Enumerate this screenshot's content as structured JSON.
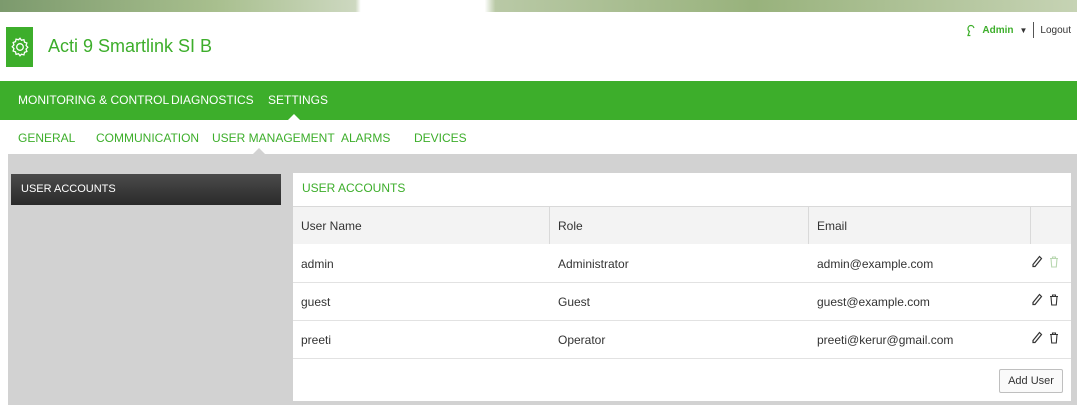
{
  "app": {
    "title": "Acti 9 Smartlink SI B"
  },
  "user": {
    "name": "Admin",
    "logout": "Logout"
  },
  "main_nav": [
    {
      "label": "MONITORING & CONTROL"
    },
    {
      "label": "DIAGNOSTICS"
    },
    {
      "label": "SETTINGS",
      "active": true
    }
  ],
  "sub_nav": [
    {
      "label": "GENERAL"
    },
    {
      "label": "COMMUNICATION"
    },
    {
      "label": "USER MANAGEMENT",
      "active": true
    },
    {
      "label": "ALARMS"
    },
    {
      "label": "DEVICES"
    }
  ],
  "sidebar": {
    "items": [
      {
        "label": "USER ACCOUNTS",
        "active": true
      }
    ]
  },
  "panel": {
    "title": "USER ACCOUNTS",
    "columns": [
      "User Name",
      "Role",
      "Email"
    ],
    "rows": [
      {
        "username": "admin",
        "role": "Administrator",
        "email": "admin@example.com"
      },
      {
        "username": "guest",
        "role": "Guest",
        "email": "guest@example.com"
      },
      {
        "username": "preeti",
        "role": "Operator",
        "email": "preeti@kerur@gmail.com"
      }
    ],
    "add_user_label": "Add User"
  },
  "icons": {
    "logo": "gear-icon",
    "user": "user-icon",
    "edit": "pencil-icon",
    "delete": "trash-icon"
  },
  "colors": {
    "brand": "#3dae2b",
    "dark_panel": "#333333",
    "background": "#d2d2d2"
  }
}
